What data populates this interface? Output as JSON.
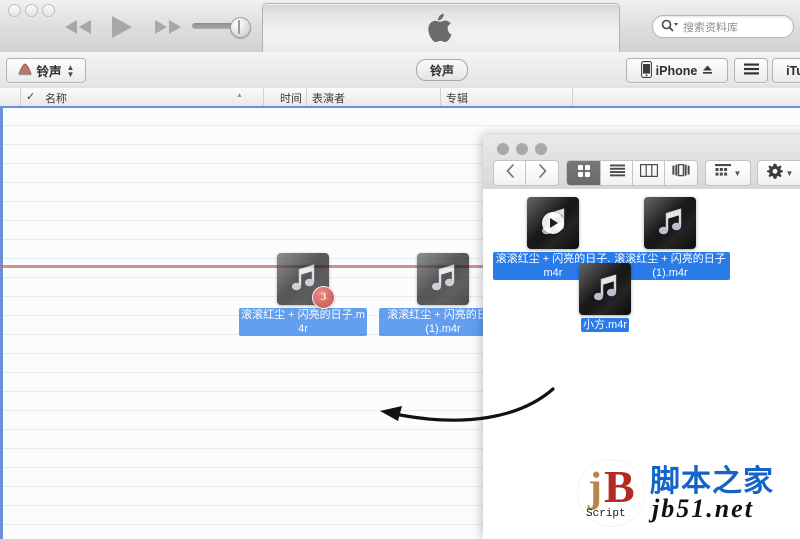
{
  "itunes": {
    "titlebar": {
      "traffic_lights": [
        "close",
        "minimize",
        "maximize"
      ],
      "transport": {
        "previous": "previous-track",
        "play": "play",
        "next": "next-track"
      },
      "volume": {
        "icon": "speaker-icon",
        "value": 78
      },
      "display": {
        "logo": "apple-logo"
      },
      "search": {
        "placeholder": "搜索资料库",
        "value": "",
        "icon": "search-icon"
      }
    },
    "navbar": {
      "source_button": {
        "label": "铃声",
        "icon": "bell-icon",
        "chevrons": "▲▼"
      },
      "active_tab": "铃声",
      "device_button": {
        "label": "iPhone",
        "icon": "iphone-icon",
        "eject": "eject-icon"
      },
      "list_button": {
        "icon": "list-view-icon"
      },
      "store_button": {
        "label": "iTu"
      }
    },
    "columns": {
      "check": "✓",
      "name": "名称",
      "sort_indicator": "▲",
      "time": "时间",
      "artist": "表演者",
      "album": "专辑"
    },
    "drop_zone": {
      "active": true,
      "highlight_color": "#6b8fd6",
      "insert_line_color": "#c96a68"
    },
    "dragged_files": [
      {
        "name": "滚滚红尘 + 闪亮的日子.m4r",
        "icon": "music-file-icon",
        "badge": "3"
      },
      {
        "name": "滚滚红尘 + 闪亮的日子(1).m4r",
        "icon": "music-file-icon",
        "badge": ""
      }
    ]
  },
  "finder": {
    "traffic_lights": [
      "close",
      "minimize",
      "maximize"
    ],
    "toolbar": {
      "back": "back-icon",
      "forward": "forward-icon",
      "view_icon": "icon-view-icon",
      "view_list": "list-view-icon",
      "view_column": "column-view-icon",
      "view_coverflow": "coverflow-view-icon",
      "arrange": "arrange-icon",
      "action": "gear-icon",
      "share": "share-icon"
    },
    "files": [
      {
        "name": "滚滚红尘 + 闪亮的日子.m4r",
        "icon": "music-file-icon",
        "selected": true,
        "playing": true
      },
      {
        "name": "滚滚红尘 + 闪亮的日子(1).m4r",
        "icon": "music-file-icon",
        "selected": true,
        "playing": false
      },
      {
        "name": "小方.m4r",
        "icon": "music-file-icon",
        "selected": true,
        "playing": false
      }
    ]
  },
  "annotation": {
    "arrow": "curved-arrow-left",
    "description": "drag from Finder into iTunes"
  },
  "watermark": {
    "mark_j": "j",
    "mark_b": "B",
    "script": "Script",
    "site_cn": "脚本之家",
    "site_url": "jb51.net"
  }
}
